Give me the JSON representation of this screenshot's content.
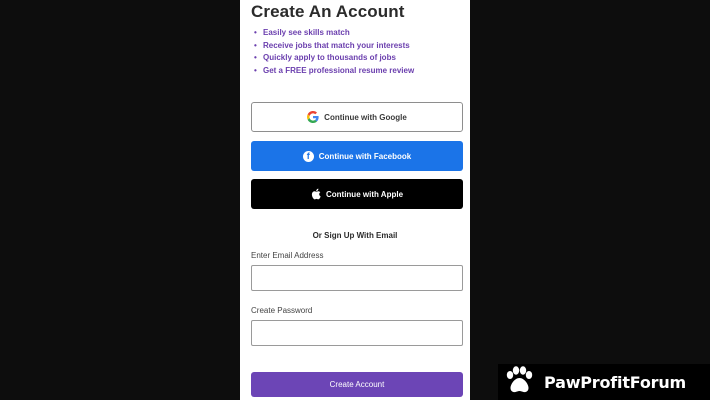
{
  "signup": {
    "title": "Create An Account",
    "benefits": [
      "Easily see skills match",
      "Receive jobs that match your interests",
      "Quickly apply to thousands of jobs",
      "Get a FREE professional resume review"
    ],
    "google_label": "Continue with Google",
    "facebook_label": "Continue with Facebook",
    "apple_label": "Continue with Apple",
    "divider": "Or Sign Up With Email",
    "email_label": "Enter Email Address",
    "email_value": "",
    "password_label": "Create Password",
    "password_value": "",
    "create_label": "Create Account"
  },
  "watermark": {
    "text": "PawProfitForum",
    "icon": "paw-icon"
  },
  "colors": {
    "accent_purple": "#6c45b6",
    "benefit_text": "#6b3fae",
    "facebook_blue": "#1b74e8",
    "apple_black": "#000000",
    "page_background": "#0d0d0d"
  },
  "icons": {
    "google": "google-icon",
    "facebook": "facebook-icon",
    "apple": "apple-icon"
  }
}
